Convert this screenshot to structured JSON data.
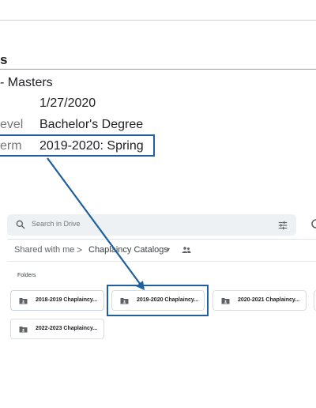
{
  "document": {
    "heading": "s",
    "rows": [
      {
        "label": "",
        "value": "- Masters"
      },
      {
        "label": "",
        "value": "1/27/2020"
      },
      {
        "label": "evel",
        "value": "Bachelor's Degree"
      },
      {
        "label": "erm",
        "value": "2019-2020: Spring"
      }
    ]
  },
  "drive": {
    "search": {
      "placeholder": "Search in Drive",
      "icon": "search-icon",
      "filter_icon": "tune-icon"
    },
    "breadcrumb": {
      "parent": "Shared with me",
      "separator": ">",
      "current": "Chaplaincy Catalogs",
      "caret": "▾",
      "shared_icon": "people-icon"
    },
    "folders_label": "Folders",
    "folders": [
      {
        "name": "2018-2019 Chaplaincy..."
      },
      {
        "name": "2019-2020 Chaplaincy..."
      },
      {
        "name": "2020-2021 Chaplaincy..."
      },
      {
        "name": ""
      },
      {
        "name": "2022-2023 Chaplaincy..."
      }
    ]
  },
  "annotation": {
    "color": "#1f5f9e"
  }
}
